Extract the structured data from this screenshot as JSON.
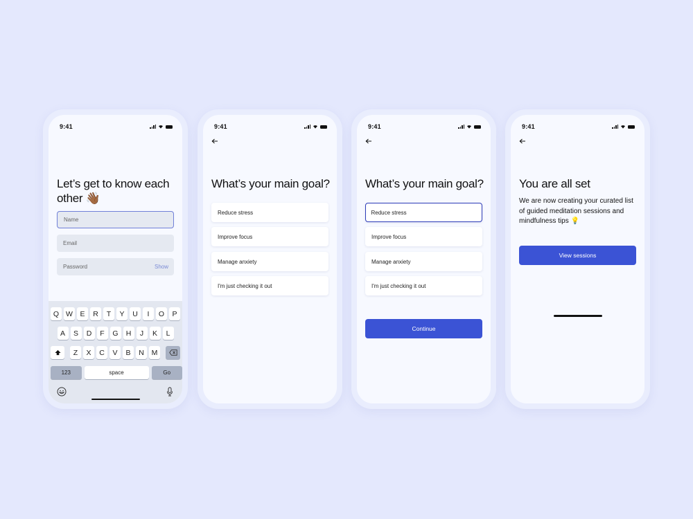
{
  "status_bar": {
    "time": "9:41"
  },
  "screens": [
    {
      "title": "Let’s get to know each other 👋🏾",
      "fields": [
        {
          "placeholder": "Name",
          "value": ""
        },
        {
          "placeholder": "Email",
          "value": ""
        },
        {
          "placeholder": "Password",
          "value": "",
          "action": "Show"
        }
      ],
      "keyboard": {
        "row1": [
          "Q",
          "W",
          "E",
          "R",
          "T",
          "Y",
          "U",
          "I",
          "O",
          "P"
        ],
        "row2": [
          "A",
          "S",
          "D",
          "F",
          "G",
          "H",
          "J",
          "K",
          "L"
        ],
        "row3": [
          "Z",
          "X",
          "C",
          "V",
          "B",
          "N",
          "M"
        ],
        "numbers_key": "123",
        "space_key": "space",
        "go_key": "Go",
        "shift_icon": "shift-icon",
        "delete_icon": "delete-icon",
        "emoji_icon": "emoji-icon",
        "mic_icon": "microphone-icon"
      }
    },
    {
      "back_icon": "arrow-left-icon",
      "title": "What’s your main goal?",
      "options": [
        "Reduce stress",
        "Improve focus",
        "Manage anxiety",
        "I'm just checking it out"
      ]
    },
    {
      "back_icon": "arrow-left-icon",
      "title": "What’s your main goal?",
      "options": [
        "Reduce stress",
        "Improve focus",
        "Manage anxiety",
        "I'm just checking it out"
      ],
      "selected_option": "Reduce stress",
      "continue_label": "Continue"
    },
    {
      "back_icon": "arrow-left-icon",
      "title": "You are all set",
      "body": "We are now creating your curated list of guided  meditation  sessions and mindfulness tips 💡",
      "button_label": "View sessions"
    }
  ],
  "colors": {
    "accent": "#3b53d5",
    "background": "#e4e8fd",
    "screen": "#f7f9ff",
    "selected_border": "#2c3bb8"
  }
}
